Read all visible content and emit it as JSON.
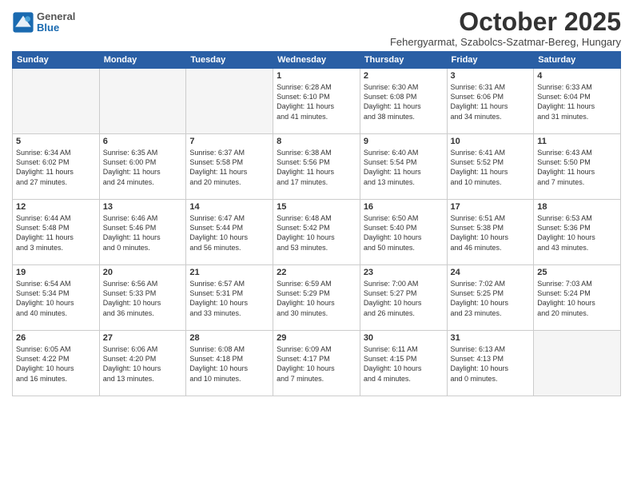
{
  "logo": {
    "general": "General",
    "blue": "Blue"
  },
  "header": {
    "title": "October 2025",
    "location": "Fehergyarmat, Szabolcs-Szatmar-Bereg, Hungary"
  },
  "weekdays": [
    "Sunday",
    "Monday",
    "Tuesday",
    "Wednesday",
    "Thursday",
    "Friday",
    "Saturday"
  ],
  "weeks": [
    [
      {
        "day": "",
        "text": ""
      },
      {
        "day": "",
        "text": ""
      },
      {
        "day": "",
        "text": ""
      },
      {
        "day": "1",
        "text": "Sunrise: 6:28 AM\nSunset: 6:10 PM\nDaylight: 11 hours\nand 41 minutes."
      },
      {
        "day": "2",
        "text": "Sunrise: 6:30 AM\nSunset: 6:08 PM\nDaylight: 11 hours\nand 38 minutes."
      },
      {
        "day": "3",
        "text": "Sunrise: 6:31 AM\nSunset: 6:06 PM\nDaylight: 11 hours\nand 34 minutes."
      },
      {
        "day": "4",
        "text": "Sunrise: 6:33 AM\nSunset: 6:04 PM\nDaylight: 11 hours\nand 31 minutes."
      }
    ],
    [
      {
        "day": "5",
        "text": "Sunrise: 6:34 AM\nSunset: 6:02 PM\nDaylight: 11 hours\nand 27 minutes."
      },
      {
        "day": "6",
        "text": "Sunrise: 6:35 AM\nSunset: 6:00 PM\nDaylight: 11 hours\nand 24 minutes."
      },
      {
        "day": "7",
        "text": "Sunrise: 6:37 AM\nSunset: 5:58 PM\nDaylight: 11 hours\nand 20 minutes."
      },
      {
        "day": "8",
        "text": "Sunrise: 6:38 AM\nSunset: 5:56 PM\nDaylight: 11 hours\nand 17 minutes."
      },
      {
        "day": "9",
        "text": "Sunrise: 6:40 AM\nSunset: 5:54 PM\nDaylight: 11 hours\nand 13 minutes."
      },
      {
        "day": "10",
        "text": "Sunrise: 6:41 AM\nSunset: 5:52 PM\nDaylight: 11 hours\nand 10 minutes."
      },
      {
        "day": "11",
        "text": "Sunrise: 6:43 AM\nSunset: 5:50 PM\nDaylight: 11 hours\nand 7 minutes."
      }
    ],
    [
      {
        "day": "12",
        "text": "Sunrise: 6:44 AM\nSunset: 5:48 PM\nDaylight: 11 hours\nand 3 minutes."
      },
      {
        "day": "13",
        "text": "Sunrise: 6:46 AM\nSunset: 5:46 PM\nDaylight: 11 hours\nand 0 minutes."
      },
      {
        "day": "14",
        "text": "Sunrise: 6:47 AM\nSunset: 5:44 PM\nDaylight: 10 hours\nand 56 minutes."
      },
      {
        "day": "15",
        "text": "Sunrise: 6:48 AM\nSunset: 5:42 PM\nDaylight: 10 hours\nand 53 minutes."
      },
      {
        "day": "16",
        "text": "Sunrise: 6:50 AM\nSunset: 5:40 PM\nDaylight: 10 hours\nand 50 minutes."
      },
      {
        "day": "17",
        "text": "Sunrise: 6:51 AM\nSunset: 5:38 PM\nDaylight: 10 hours\nand 46 minutes."
      },
      {
        "day": "18",
        "text": "Sunrise: 6:53 AM\nSunset: 5:36 PM\nDaylight: 10 hours\nand 43 minutes."
      }
    ],
    [
      {
        "day": "19",
        "text": "Sunrise: 6:54 AM\nSunset: 5:34 PM\nDaylight: 10 hours\nand 40 minutes."
      },
      {
        "day": "20",
        "text": "Sunrise: 6:56 AM\nSunset: 5:33 PM\nDaylight: 10 hours\nand 36 minutes."
      },
      {
        "day": "21",
        "text": "Sunrise: 6:57 AM\nSunset: 5:31 PM\nDaylight: 10 hours\nand 33 minutes."
      },
      {
        "day": "22",
        "text": "Sunrise: 6:59 AM\nSunset: 5:29 PM\nDaylight: 10 hours\nand 30 minutes."
      },
      {
        "day": "23",
        "text": "Sunrise: 7:00 AM\nSunset: 5:27 PM\nDaylight: 10 hours\nand 26 minutes."
      },
      {
        "day": "24",
        "text": "Sunrise: 7:02 AM\nSunset: 5:25 PM\nDaylight: 10 hours\nand 23 minutes."
      },
      {
        "day": "25",
        "text": "Sunrise: 7:03 AM\nSunset: 5:24 PM\nDaylight: 10 hours\nand 20 minutes."
      }
    ],
    [
      {
        "day": "26",
        "text": "Sunrise: 6:05 AM\nSunset: 4:22 PM\nDaylight: 10 hours\nand 16 minutes."
      },
      {
        "day": "27",
        "text": "Sunrise: 6:06 AM\nSunset: 4:20 PM\nDaylight: 10 hours\nand 13 minutes."
      },
      {
        "day": "28",
        "text": "Sunrise: 6:08 AM\nSunset: 4:18 PM\nDaylight: 10 hours\nand 10 minutes."
      },
      {
        "day": "29",
        "text": "Sunrise: 6:09 AM\nSunset: 4:17 PM\nDaylight: 10 hours\nand 7 minutes."
      },
      {
        "day": "30",
        "text": "Sunrise: 6:11 AM\nSunset: 4:15 PM\nDaylight: 10 hours\nand 4 minutes."
      },
      {
        "day": "31",
        "text": "Sunrise: 6:13 AM\nSunset: 4:13 PM\nDaylight: 10 hours\nand 0 minutes."
      },
      {
        "day": "",
        "text": ""
      }
    ]
  ]
}
